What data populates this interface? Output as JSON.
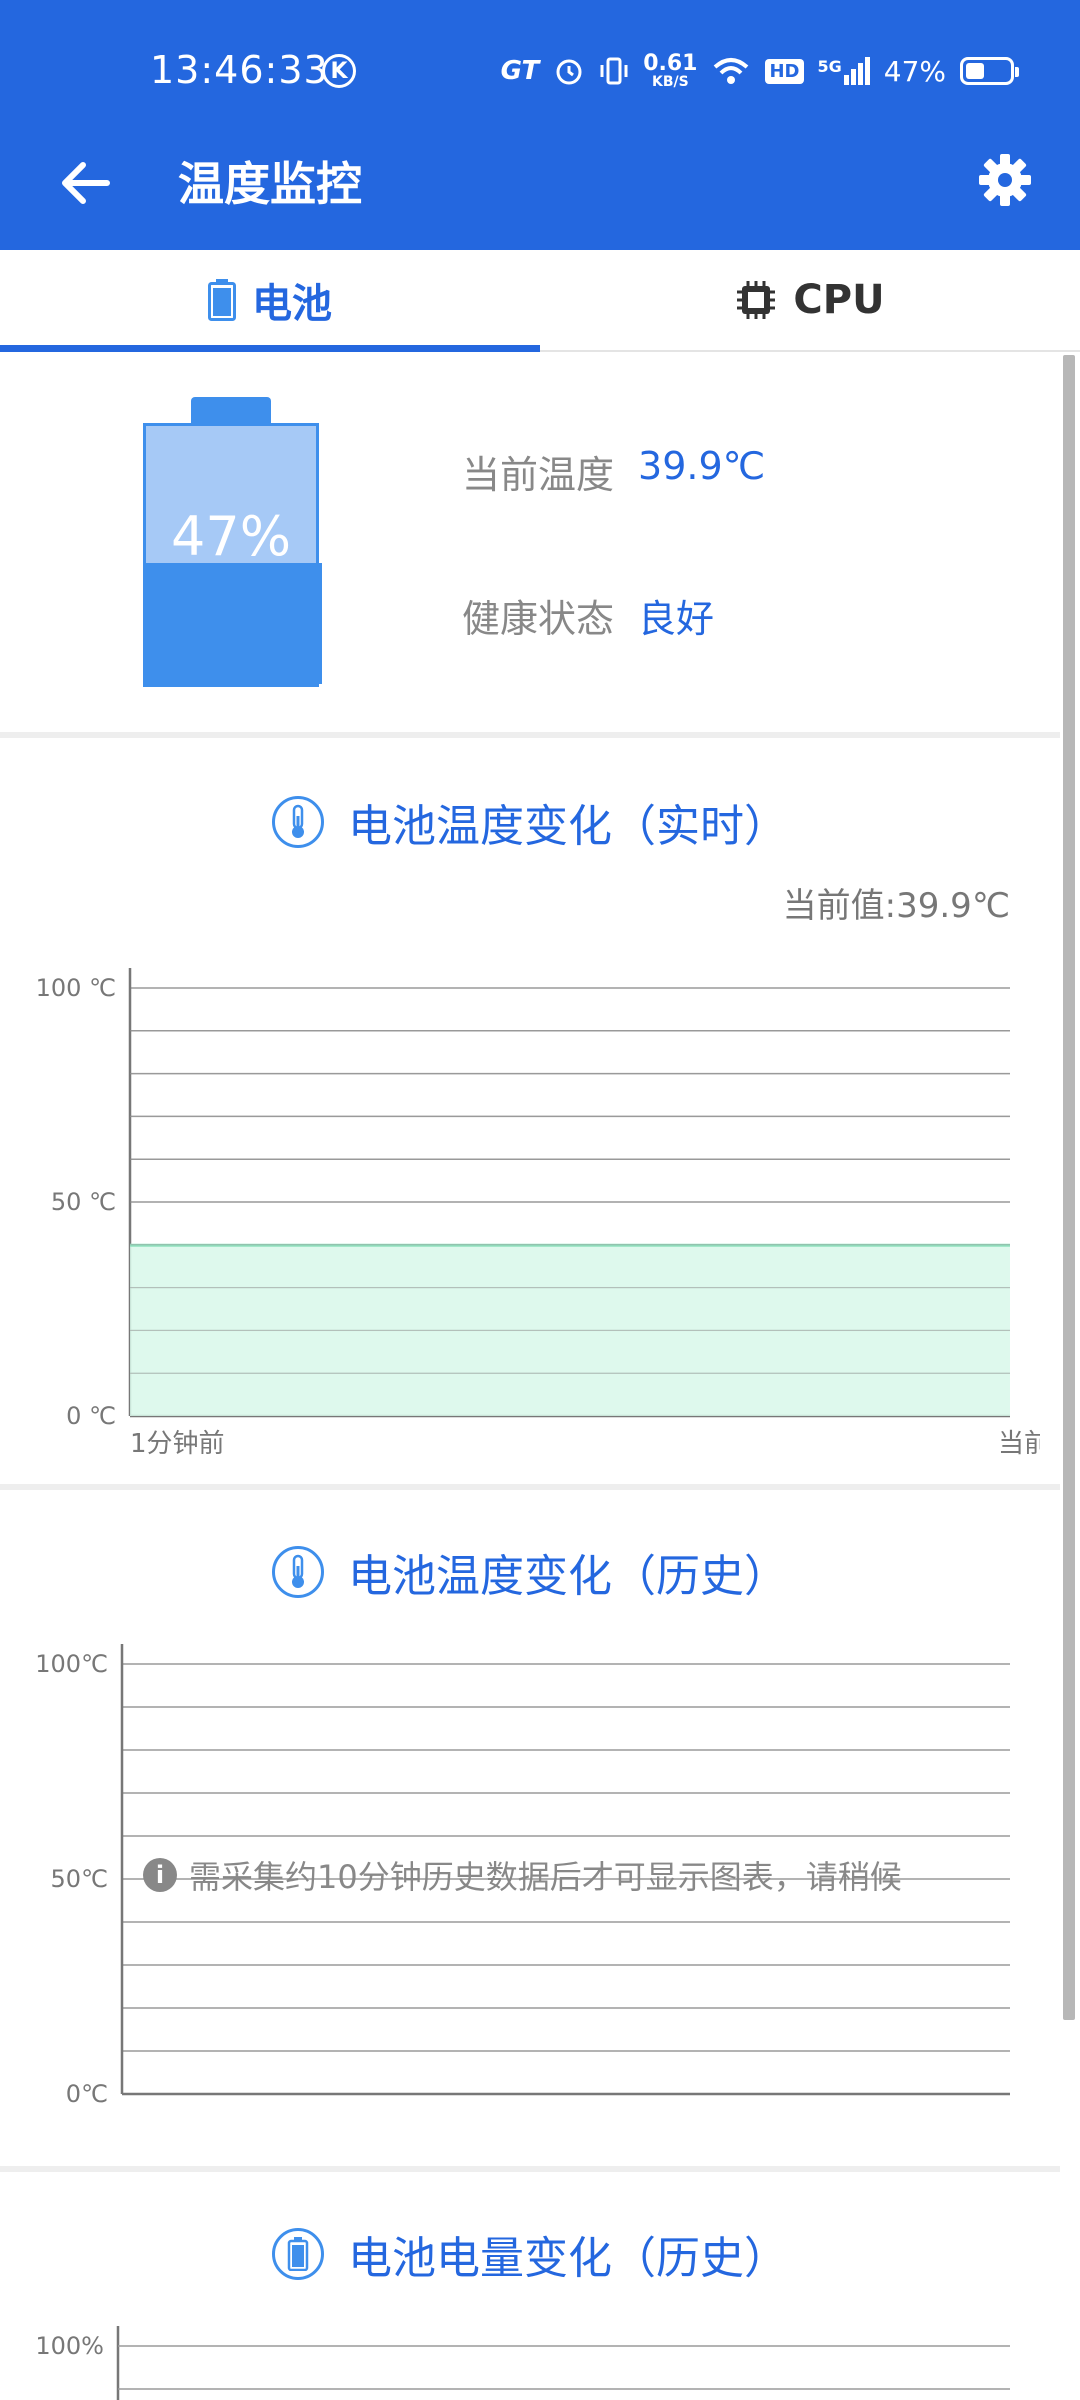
{
  "status_bar": {
    "time": "13:46:33",
    "k_badge": "K",
    "gt_label": "GT",
    "speed_value": "0.61",
    "speed_unit": "KB/S",
    "hd_label": "HD",
    "signal_label": "5G",
    "battery_percent": "47%"
  },
  "app_bar": {
    "title": "温度监控"
  },
  "tabs": [
    {
      "label": "电池",
      "icon": "battery-icon",
      "active": true
    },
    {
      "label": "CPU",
      "icon": "cpu-icon",
      "active": false
    }
  ],
  "battery_summary": {
    "level_text": "47%",
    "level_fraction": 0.47,
    "current_temp_label": "当前温度",
    "current_temp_value": "39.9℃",
    "health_label": "健康状态",
    "health_value": "良好"
  },
  "realtime_chart_section": {
    "title": "电池温度变化（实时）",
    "current_value_text": "当前值:39.9℃"
  },
  "history_temp_section": {
    "title": "电池温度变化（历史）",
    "note": "需采集约10分钟历史数据后才可显示图表，请稍候"
  },
  "history_level_section": {
    "title": "电池电量变化（历史）"
  },
  "colors": {
    "primary": "#2467df",
    "battery_fill": "#3e8fec",
    "battery_empty": "#a6c9f6",
    "area_fill": "#d8f8ea",
    "area_line": "#8fe3bf"
  },
  "chart_data": [
    {
      "type": "area",
      "series": [
        {
          "values": [
            39.9,
            39.9
          ]
        }
      ],
      "x_tick_labels": [
        "1分钟前",
        "当前"
      ],
      "y_tick_labels": [
        "100 ℃",
        "50 ℃",
        "0 ℃"
      ],
      "ylim": [
        0,
        100
      ],
      "grid": true
    },
    {
      "type": "line",
      "series": [],
      "y_tick_labels": [
        "100℃",
        "50℃",
        "0℃"
      ],
      "ylim": [
        0,
        100
      ],
      "grid": true
    },
    {
      "type": "line",
      "series": [],
      "y_tick_labels": [
        "100%"
      ],
      "grid": true
    }
  ]
}
